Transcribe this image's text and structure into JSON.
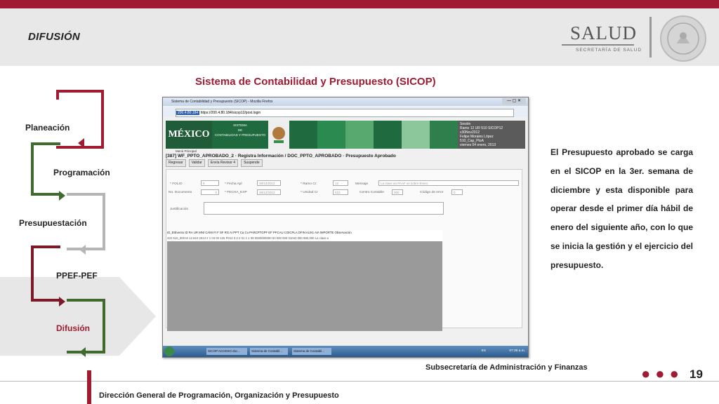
{
  "slide": {
    "title": "DIFUSIÓN",
    "subtitle": "Sistema de Contabilidad y Presupuesto (SICOP)",
    "page_number": "19",
    "footer_org": "Subsecretaría de Administración y Finanzas",
    "footer_dir": "Dirección General de Programación, Organización y Presupuesto",
    "body_text": "El Presupuesto aprobado se carga en el SICOP en la 3er. semana de diciembre y esta disponible para operar desde el primer día hábil de enero del siguiente año, con lo que se inicia la gestión y el ejercicio del presupuesto."
  },
  "logo": {
    "name": "SALUD",
    "sub": "SECRETARÍA DE SALUD"
  },
  "flow": {
    "items": [
      "Planeación",
      "Programación",
      "Presupuestación",
      "PPEF-PEF",
      "Difusión"
    ],
    "active": "Difusión",
    "colors": {
      "red": "#9e1b32",
      "green": "#3f6b2e",
      "gray": "#b5b5b5"
    }
  },
  "screenshot": {
    "window_title": "Sistema de Contabilidad y Presupuesto (SICOP) - Mozilla Firefox",
    "ip": "200.4.80.184",
    "url": "https://200.4.80.184/sicop12/post.login",
    "mexico": "MÉXICO",
    "system_lines": [
      "SISTEMA",
      "DE",
      "CONTABILIDAD Y PRESUPUESTO"
    ],
    "menu": "Menú Principal",
    "session": [
      "Sesión",
      "Ramo 12 UR 510   SICOP12 v30Nov2012",
      "Felipe Morales López",
      "510_Cap_PtoA",
      "viernes 04 enero, 2013"
    ],
    "breadcrumb": "[387]  WF_PPTO_APROBADO_2 · Registra Información / DOC_PPTO_APROBADO · Presupuesto Aprobado",
    "actions": [
      "Regresar",
      "Validar",
      "Envía Revisor 4",
      "Suspende"
    ],
    "fields": {
      "folio_label": "* FOLIO",
      "folio_value": "5",
      "fecha_apl_label": "* Fecha Apl",
      "fecha_apl_value": "28/12/2012",
      "ramo_label": "* Ramo Cr",
      "ramo_value": "12",
      "mensaje_label": "Mensaje",
      "mensaje_value": "La clave en PAAF se sobre Enero",
      "no_doc_label": "No. Documento",
      "no_doc_value": "0",
      "fecha_exp_label": "* FECHA_EXP",
      "fecha_exp_value": "28/12/2012",
      "unidad_label": "* Unidad Cr",
      "unidad_value": "510",
      "centro_label": "Centro Contable",
      "centro_value": "000",
      "codigo_label": "Código de error",
      "codigo_value": "0",
      "justificacion_label": "Justificación"
    },
    "grid_header": "ID_EtEvento  ID RA UR MNI CAMI  FI F  SF  RG AI   PPT   Ca  Cu  PARCPTGPF EF  PFCAU   COICPLA OFIN AUX1 AIA IMPORTE   Observación",
    "grid_row": "422  510_000  M  12  610  2013  2  1  04  00  125  P012  3  3  2  01  1  1  09  0000000000  00  000  000  01040  000   980,000  La clave e",
    "taskbar_items": [
      "SICOP ACCESO doc...",
      "Sistema de Contabil...",
      "Sistema de Contabil..."
    ],
    "tray_lang": "ES",
    "clock": "07:38 a.m."
  }
}
